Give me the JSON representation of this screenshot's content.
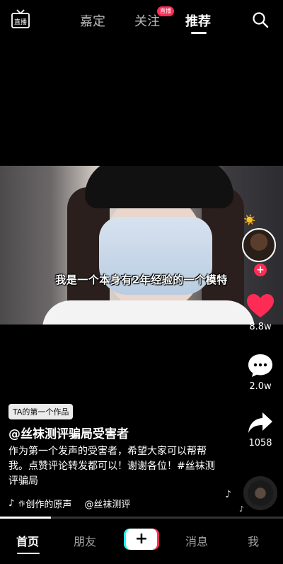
{
  "top_nav": {
    "live_icon_label": "直播",
    "tabs": [
      {
        "label": "嘉定"
      },
      {
        "label": "关注"
      },
      {
        "label": "推荐"
      }
    ],
    "live_badge": "直播",
    "active_tab": "推荐"
  },
  "video": {
    "subtitle": "我是一个本身有2年经验的一个模特"
  },
  "actions": {
    "likes": "8.8w",
    "comments": "2.0w",
    "shares": "1058"
  },
  "post": {
    "tag": "TA的第一个作品",
    "author": "@丝袜测评骗局受害者",
    "description": "作为第一个发声的受害者，希望大家可以帮帮我。点赞评论转发都可以！谢谢各位！#丝袜测评骗局",
    "music": "创作的原声",
    "music_prefix": "作",
    "music_author": "@丝袜测评",
    "progress": 0.18
  },
  "bottom_nav": {
    "items": [
      {
        "label": "首页"
      },
      {
        "label": "朋友"
      },
      {
        "label": "+"
      },
      {
        "label": "消息"
      },
      {
        "label": "我"
      }
    ]
  },
  "colors": {
    "accent_red": "#fe2c55",
    "accent_cyan": "#25f4ee",
    "background": "#000000"
  }
}
